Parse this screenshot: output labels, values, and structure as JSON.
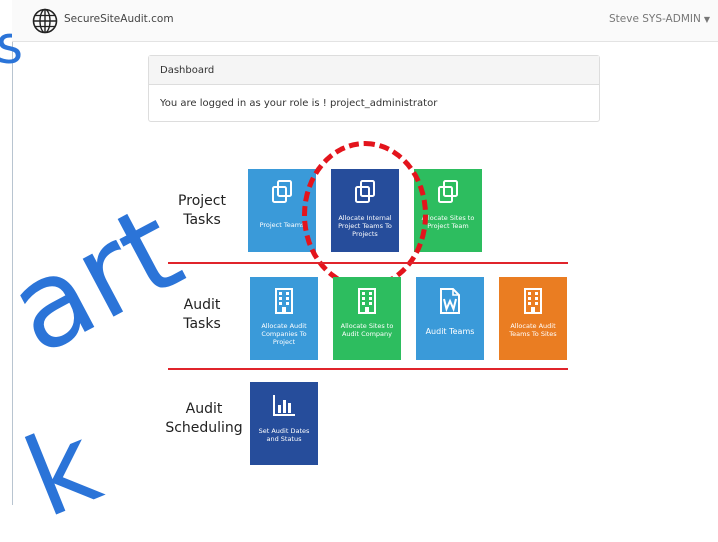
{
  "navbar": {
    "brand": "SecureSiteAudit.com",
    "user": "Steve SYS-ADMIN",
    "brand_icon": "globe-icon",
    "caret_icon": "caret-down-icon"
  },
  "background_text": {
    "s": "s",
    "art": "art",
    "k": "k"
  },
  "panel": {
    "heading": "Dashboard",
    "body": "You are logged in as your role is ! project_administrator"
  },
  "sections": {
    "project": {
      "label_1": "Project",
      "label_2": "Tasks"
    },
    "audit": {
      "label_1": "Audit",
      "label_2": "Tasks"
    },
    "scheduling": {
      "label_1": "Audit",
      "label_2": "Scheduling"
    }
  },
  "tiles": {
    "project_teams": {
      "label": "Project Teams",
      "icon": "copy-icon",
      "color": "#3a9ad9"
    },
    "allocate_internal": {
      "l1": "Allocate Internal",
      "l2": "Project Teams To",
      "l3": "Projects",
      "icon": "copy-icon",
      "color": "#264d9b"
    },
    "allocate_sites_team": {
      "l1": "Allocate Sites to",
      "l2": "Project Team",
      "icon": "copy-icon",
      "color": "#2dbd5f"
    },
    "allocate_audit_companies": {
      "l1": "Allocate Audit",
      "l2": "Companies To",
      "l3": "Project",
      "icon": "building-icon",
      "color": "#3a9ad9"
    },
    "allocate_sites_company": {
      "l1": "Allocate Sites to",
      "l2": "Audit Company",
      "icon": "building-icon",
      "color": "#2dbd5f"
    },
    "audit_teams": {
      "label": "Audit Teams",
      "icon": "word-document-icon",
      "color": "#3a9ad9"
    },
    "allocate_audit_teams": {
      "l1": "Allocate Audit",
      "l2": "Teams To Sites",
      "icon": "building-icon",
      "color": "#ea7d22"
    },
    "set_audit_dates": {
      "l1": "Set Audit Dates",
      "l2": "and Status",
      "icon": "bar-chart-icon",
      "color": "#264d9b"
    }
  },
  "colors": {
    "divider": "#e0242b",
    "highlight": "#e3141c",
    "watermark": "#2b74d8"
  }
}
